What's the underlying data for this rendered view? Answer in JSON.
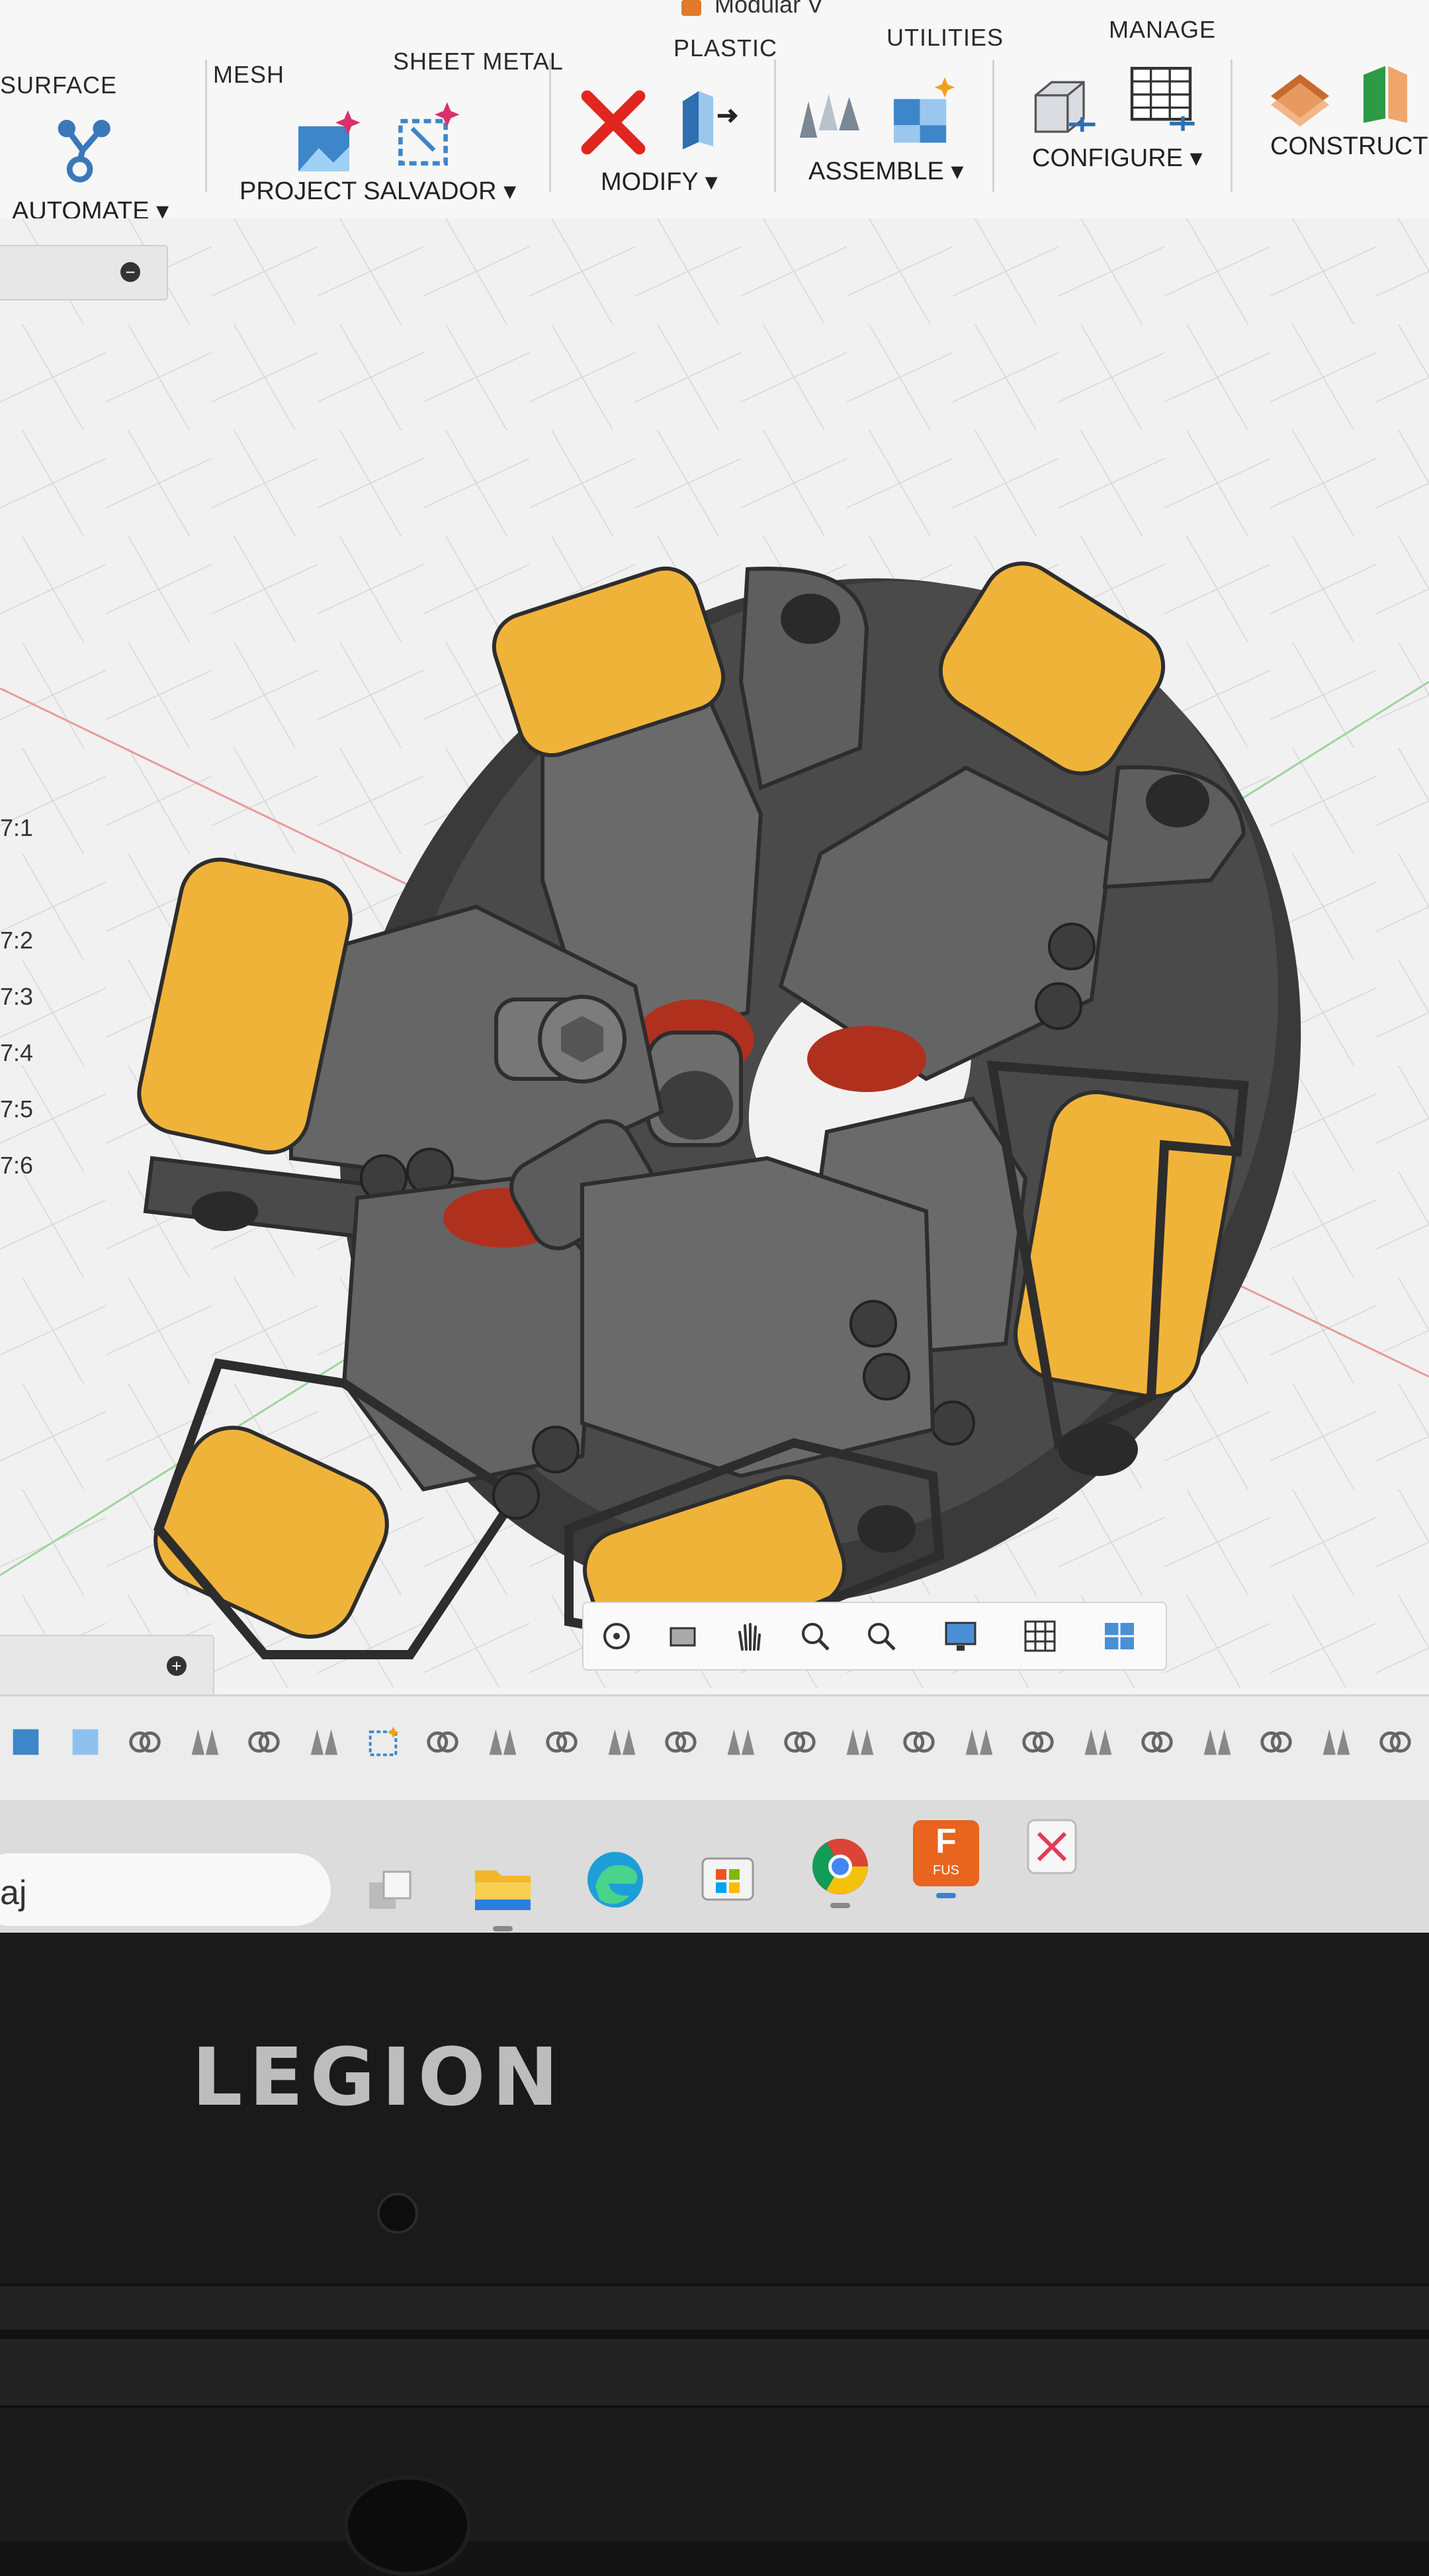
{
  "window": {
    "title": "Modular V"
  },
  "toolbar": {
    "tabs": [
      "SURFACE",
      "MESH",
      "SHEET METAL",
      "PLASTIC",
      "UTILITIES",
      "MANAGE"
    ],
    "groups": [
      "AUTOMATE ▾",
      "PROJECT SALVADOR ▾",
      "MODIFY ▾",
      "ASSEMBLE ▾",
      "CONFIGURE ▾",
      "CONSTRUCT"
    ]
  },
  "browser": {
    "rows": [
      "7:1",
      "7:2",
      "7:3",
      "7:4",
      "7:5",
      "7:6"
    ],
    "collapse_symbol": "−",
    "expand_symbol": "+"
  },
  "navbar": {
    "icons": [
      "orbit-icon",
      "look-at-icon",
      "pan-icon",
      "zoom-window-icon",
      "fit-icon",
      "display-settings-icon",
      "grid-settings-icon",
      "viewports-icon"
    ]
  },
  "taskbar": {
    "search_text": "aj",
    "apps": [
      "task-view-icon",
      "file-explorer-icon",
      "edge-icon",
      "microsoft-store-icon",
      "chrome-icon",
      "fusion-icon",
      "snipping-tool-icon"
    ],
    "fusion_label": "F",
    "fusion_sub": "FUS"
  },
  "device": {
    "brand": "LEGION"
  },
  "colors": {
    "accent": "#e07a2a",
    "roller": "#f0b33a",
    "hub": "#5c5c5c",
    "seal": "#b0301e"
  }
}
